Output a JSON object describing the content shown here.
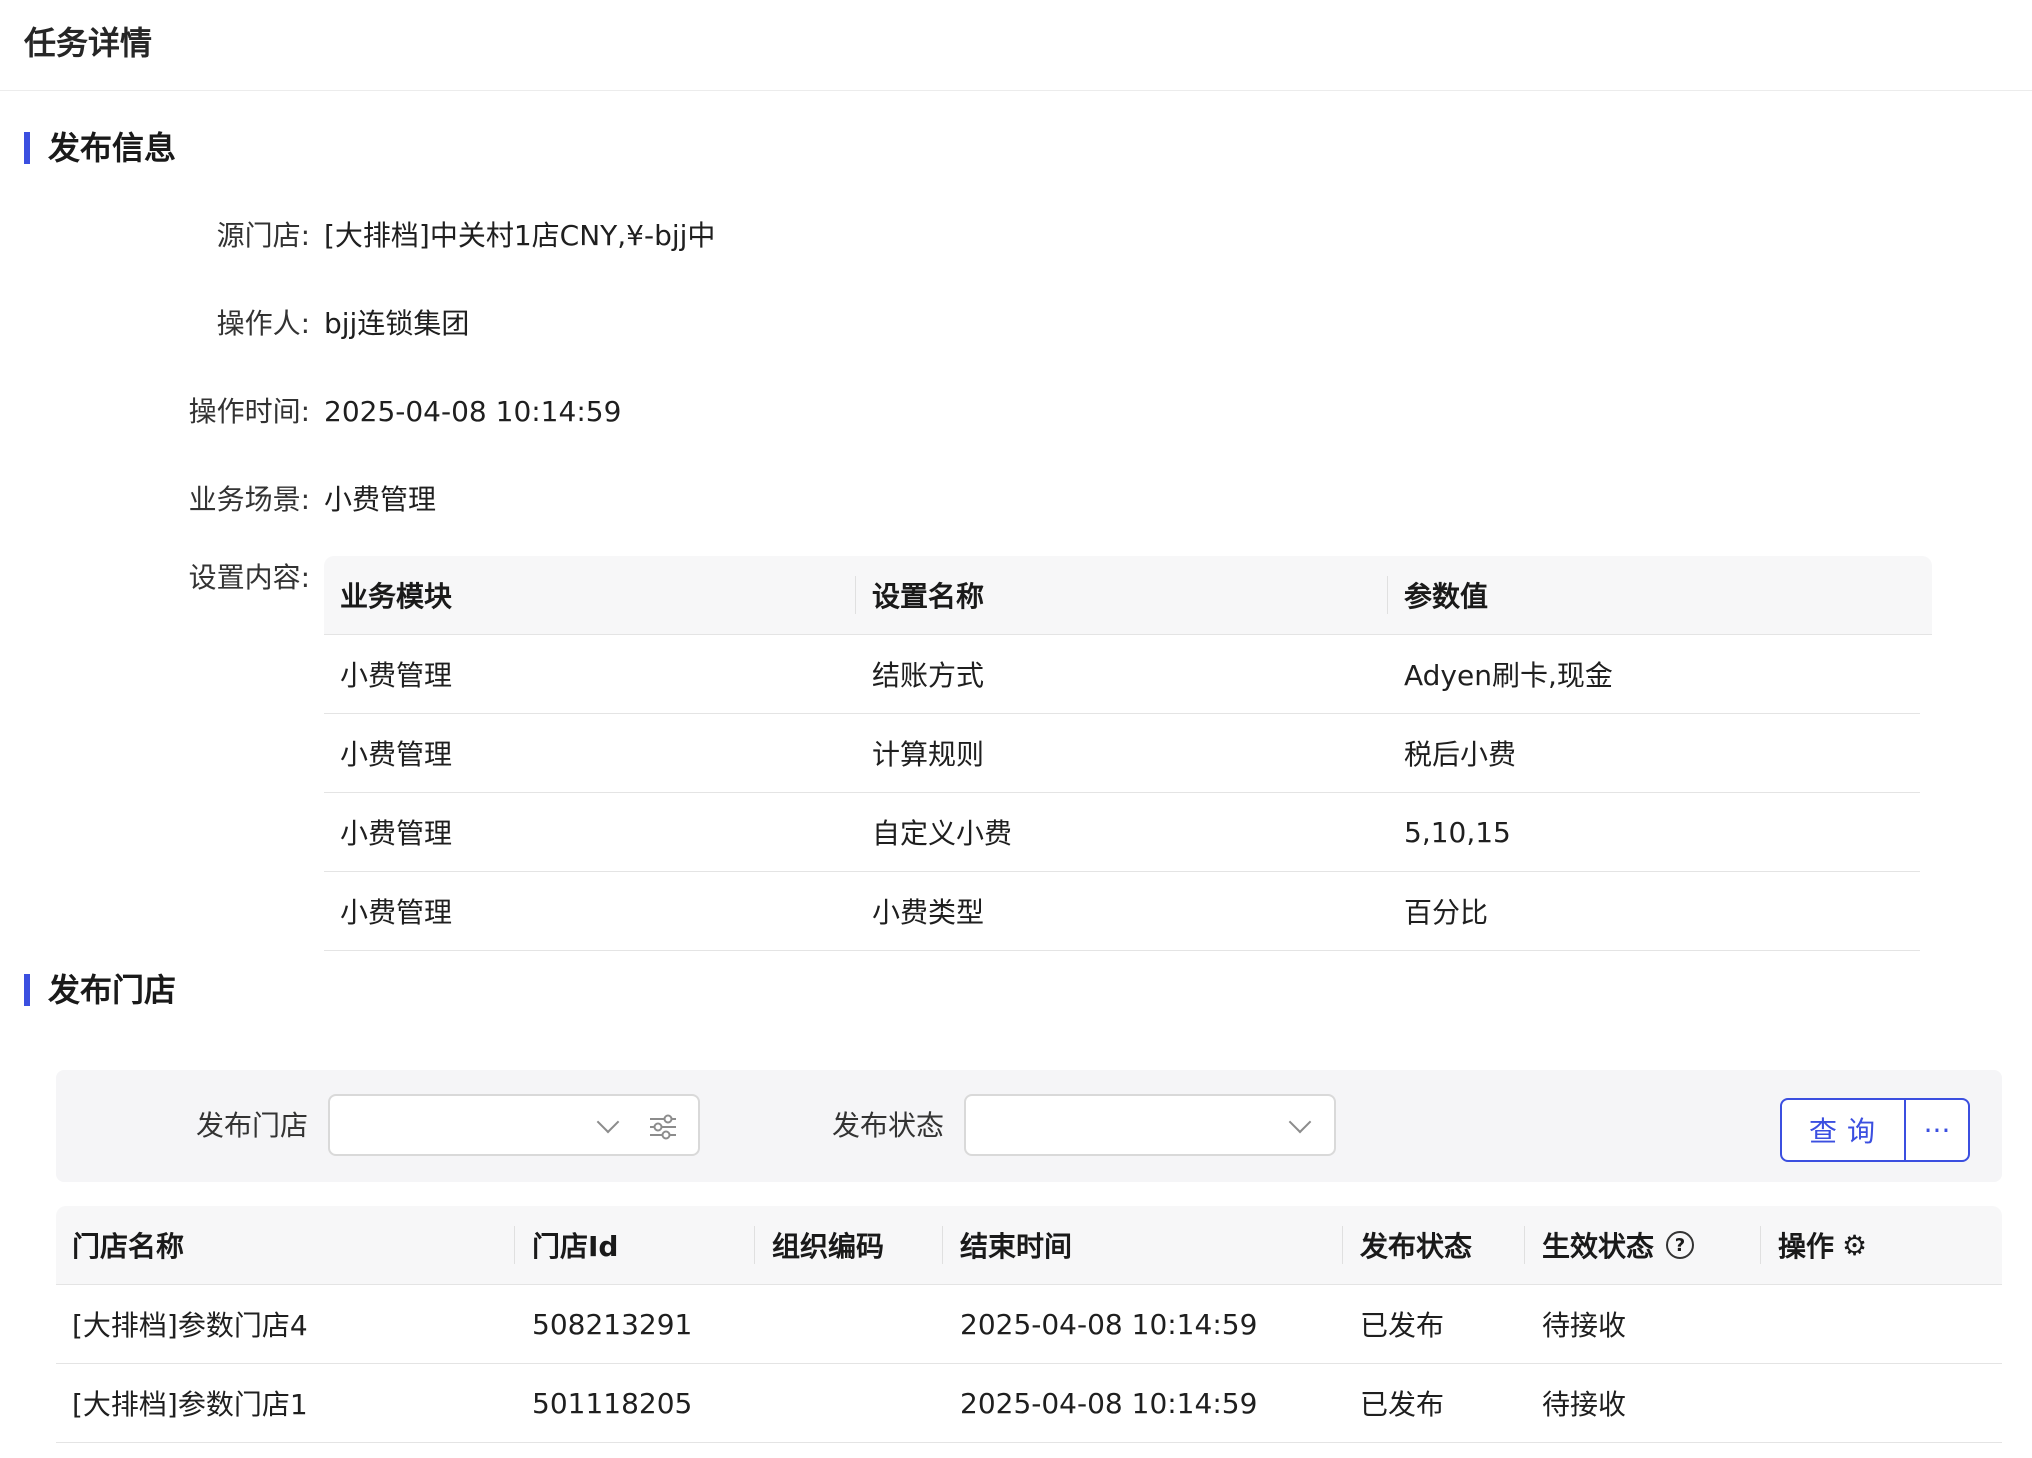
{
  "page": {
    "title": "任务详情"
  },
  "publish_info": {
    "section_title": "发布信息",
    "fields": [
      {
        "label": "源门店:",
        "value": "[大排档]中关村1店CNY,¥-bjj中"
      },
      {
        "label": "操作人:",
        "value": "bjj连锁集团"
      },
      {
        "label": "操作时间:",
        "value": "2025-04-08 10:14:59"
      },
      {
        "label": "业务场景:",
        "value": "小费管理"
      }
    ],
    "settings_label": "设置内容:",
    "settings_table": {
      "columns": [
        "业务模块",
        "设置名称",
        "参数值"
      ],
      "rows": [
        [
          "小费管理",
          "结账方式",
          "Adyen刷卡,现金"
        ],
        [
          "小费管理",
          "计算规则",
          "税后小费"
        ],
        [
          "小费管理",
          "自定义小费",
          "5,10,15"
        ],
        [
          "小费管理",
          "小费类型",
          "百分比"
        ]
      ]
    }
  },
  "publish_stores": {
    "section_title": "发布门店",
    "filters": {
      "store_label": "发布门店",
      "status_label": "发布状态",
      "query_button": "查询",
      "more_button": "···"
    },
    "table": {
      "columns": [
        "门店名称",
        "门店Id",
        "组织编码",
        "结束时间",
        "发布状态",
        "生效状态",
        "操作"
      ],
      "rows": [
        [
          "[大排档]参数门店4",
          "508213291",
          "",
          "2025-04-08 10:14:59",
          "已发布",
          "待接收"
        ],
        [
          "[大排档]参数门店1",
          "501118205",
          "",
          "2025-04-08 10:14:59",
          "已发布",
          "待接收"
        ]
      ]
    }
  },
  "icons": {
    "help": "question-circle-icon",
    "settings": "gear-icon",
    "dropdown": "chevron-down-icon",
    "filter": "sliders-icon"
  },
  "colors": {
    "accent": "#3b4fe0"
  }
}
